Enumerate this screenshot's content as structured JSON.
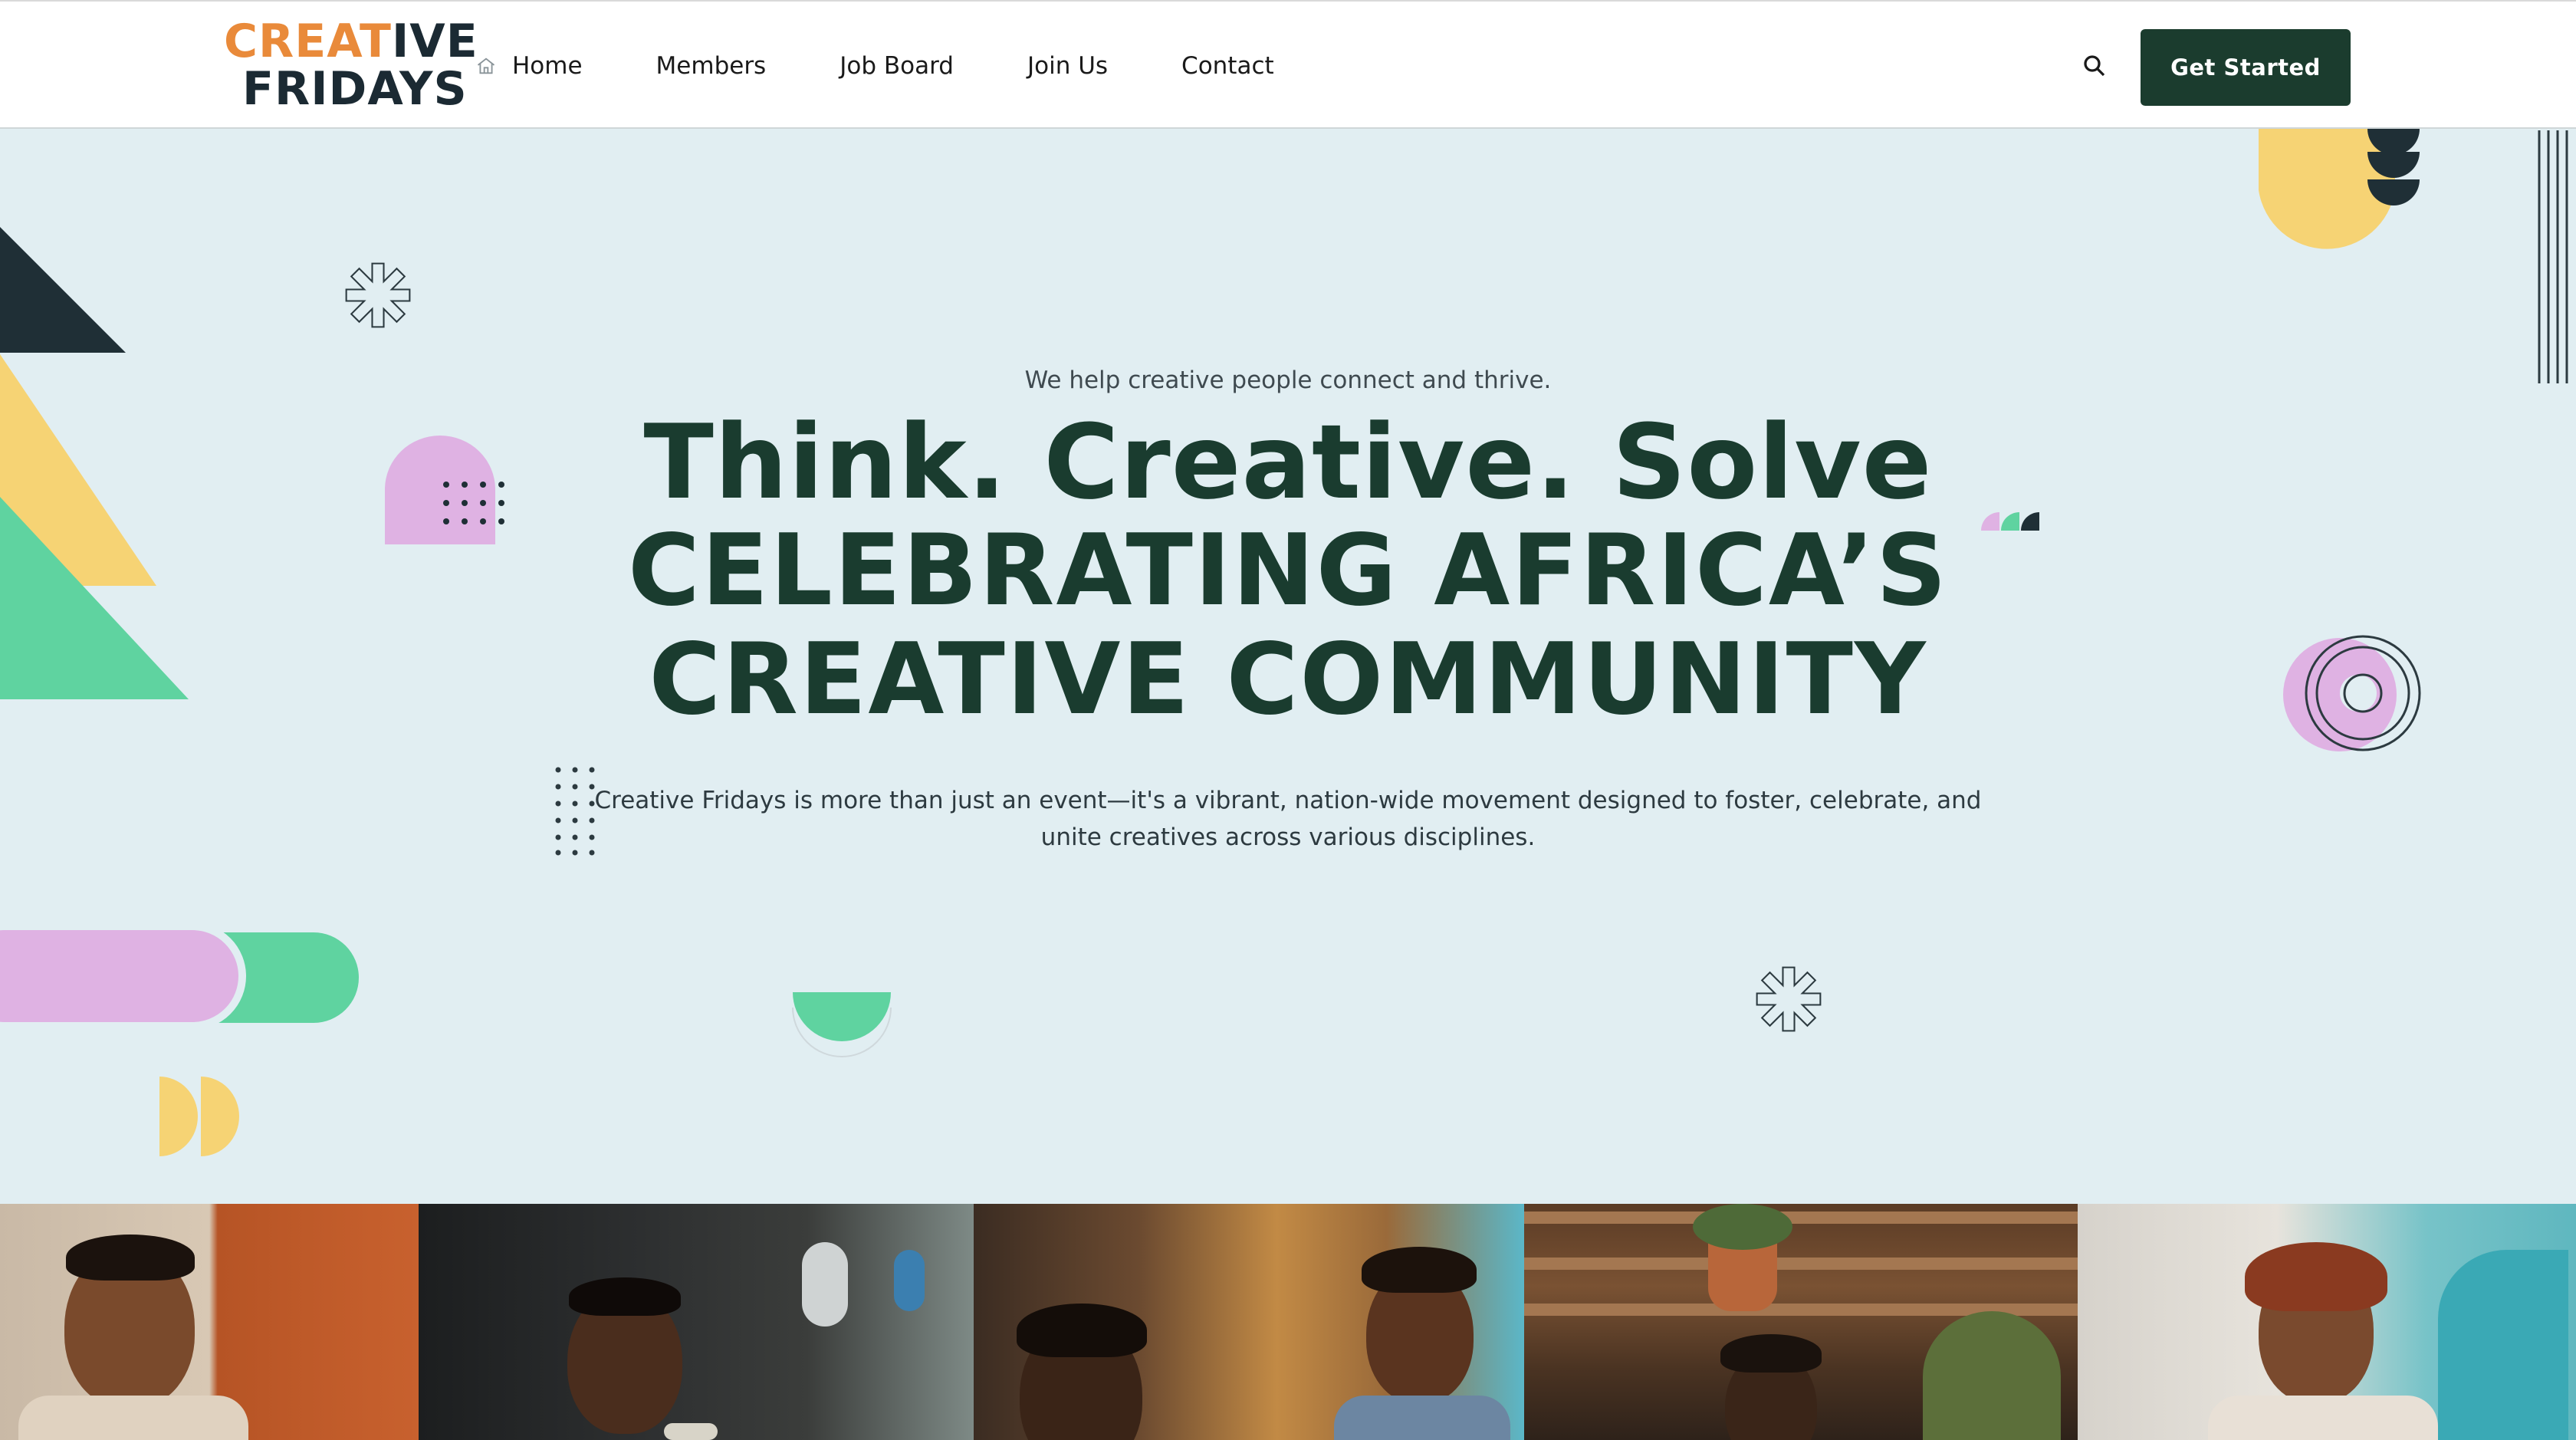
{
  "brand": {
    "logo_line1_accent": "CREAT",
    "logo_line1_rest": "IVE",
    "logo_line2": "FRIDAYS",
    "primary": "#1b3c2e",
    "accent": "#e98a3a",
    "background": "#e1eef2"
  },
  "nav": {
    "items": [
      {
        "label": "Home",
        "icon": "home-icon"
      },
      {
        "label": "Members"
      },
      {
        "label": "Job Board"
      },
      {
        "label": "Join Us"
      },
      {
        "label": "Contact"
      }
    ],
    "search_icon": "search-icon",
    "cta_label": "Get Started"
  },
  "hero": {
    "kicker": "We help creative people connect and thrive.",
    "title_line1": "Think. Creative. Solve",
    "title_line2": "CELEBRATING AFRICA’S",
    "title_line3": "CREATIVE COMMUNITY",
    "description": "Creative Fridays is more than just an event—it's a vibrant, nation-wide movement designed to foster, celebrate, and unite creatives across various disciplines."
  },
  "decor_colors": {
    "green": "#5fd3a0",
    "yellow": "#f6d374",
    "pink": "#dfb2e3",
    "dark": "#1f2f36"
  },
  "photos": [
    {
      "subject": "man-with-sunglasses-on-head"
    },
    {
      "subject": "man-speaking-into-microphone"
    },
    {
      "subject": "man-with-braids-and-smiling-woman"
    },
    {
      "subject": "man-with-dreadlocks-on-stairs"
    },
    {
      "subject": "smiling-woman-with-braids"
    }
  ]
}
